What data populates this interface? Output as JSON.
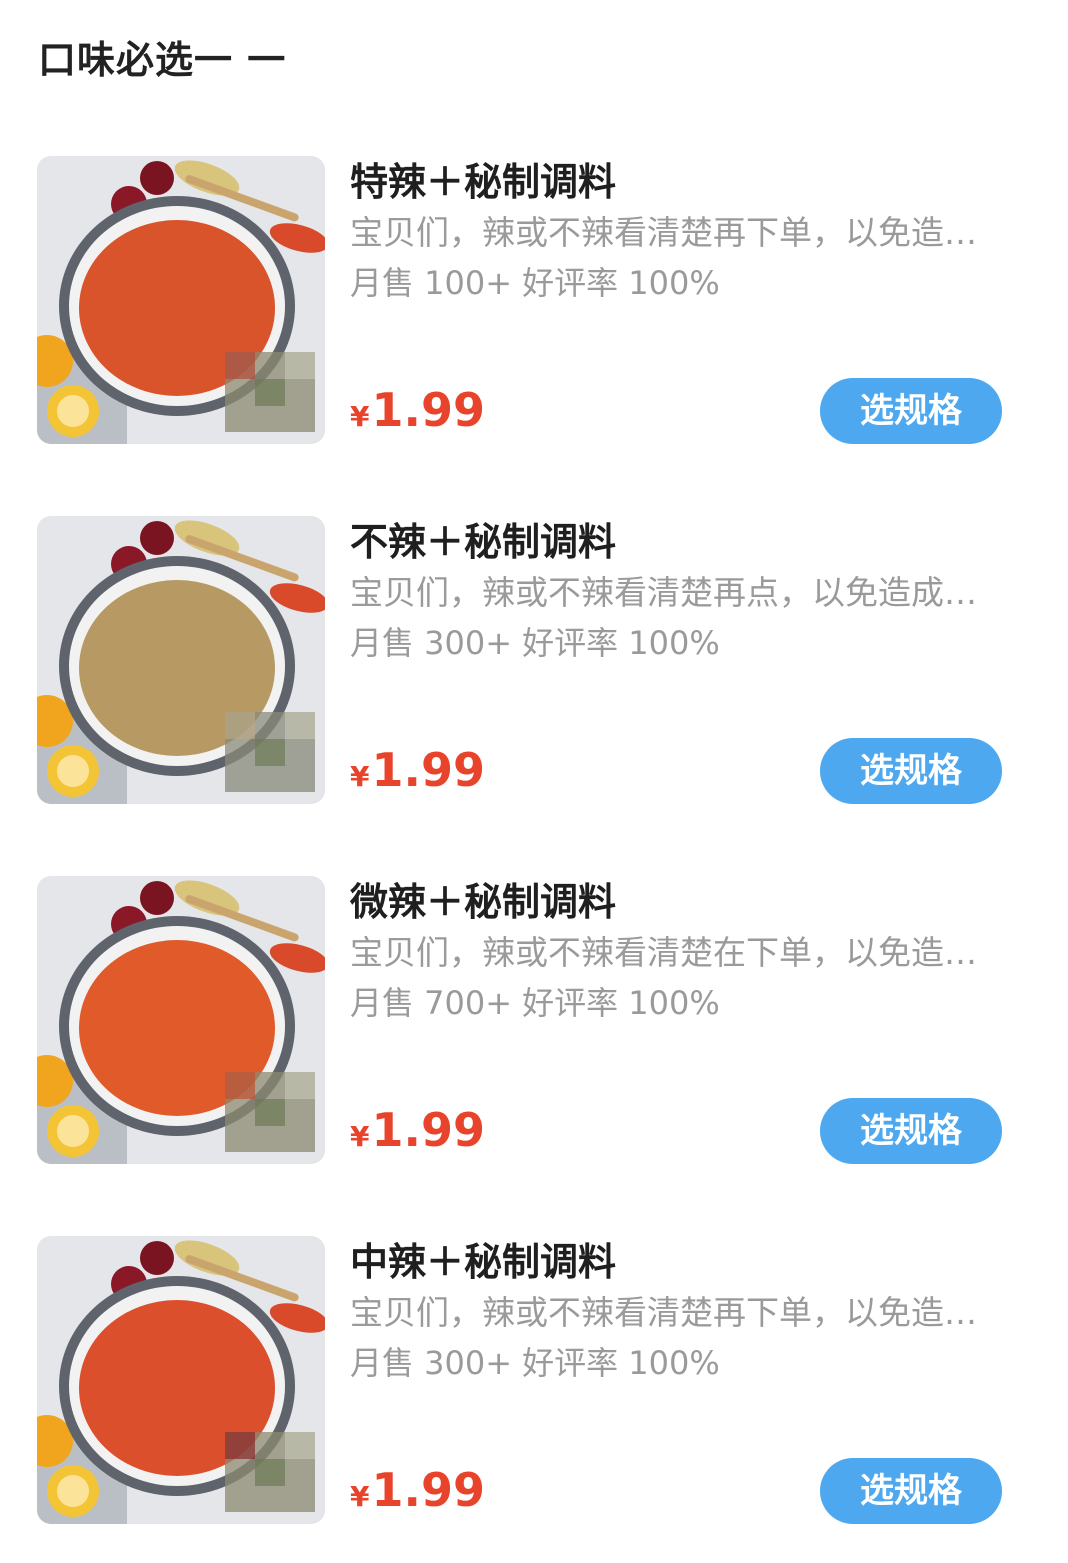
{
  "section": {
    "title": "口味必选一 一"
  },
  "products": [
    {
      "name": "特辣＋秘制调料",
      "description": "宝贝们，辣或不辣看清楚再下单，以免造成误会",
      "monthly_sales": "月售 100+",
      "rating": "好评率 100%",
      "currency": "¥",
      "price": "1.99",
      "button_label": "选规格",
      "powder_color": "#d9532b"
    },
    {
      "name": "不辣＋秘制调料",
      "description": "宝贝们，辣或不辣看清楚再点，以免造成误会",
      "monthly_sales": "月售 300+",
      "rating": "好评率 100%",
      "currency": "¥",
      "price": "1.99",
      "button_label": "选规格",
      "powder_color": "#b79a63"
    },
    {
      "name": "微辣＋秘制调料",
      "description": "宝贝们，辣或不辣看清楚在下单，以免造成误会",
      "monthly_sales": "月售 700+",
      "rating": "好评率 100%",
      "currency": "¥",
      "price": "1.99",
      "button_label": "选规格",
      "powder_color": "#e05a2a"
    },
    {
      "name": "中辣＋秘制调料",
      "description": "宝贝们，辣或不辣看清楚再下单，以免造成误会",
      "monthly_sales": "月售 300+",
      "rating": "好评率 100%",
      "currency": "¥",
      "price": "1.99",
      "button_label": "选规格",
      "powder_color": "#dc4f2c"
    }
  ]
}
